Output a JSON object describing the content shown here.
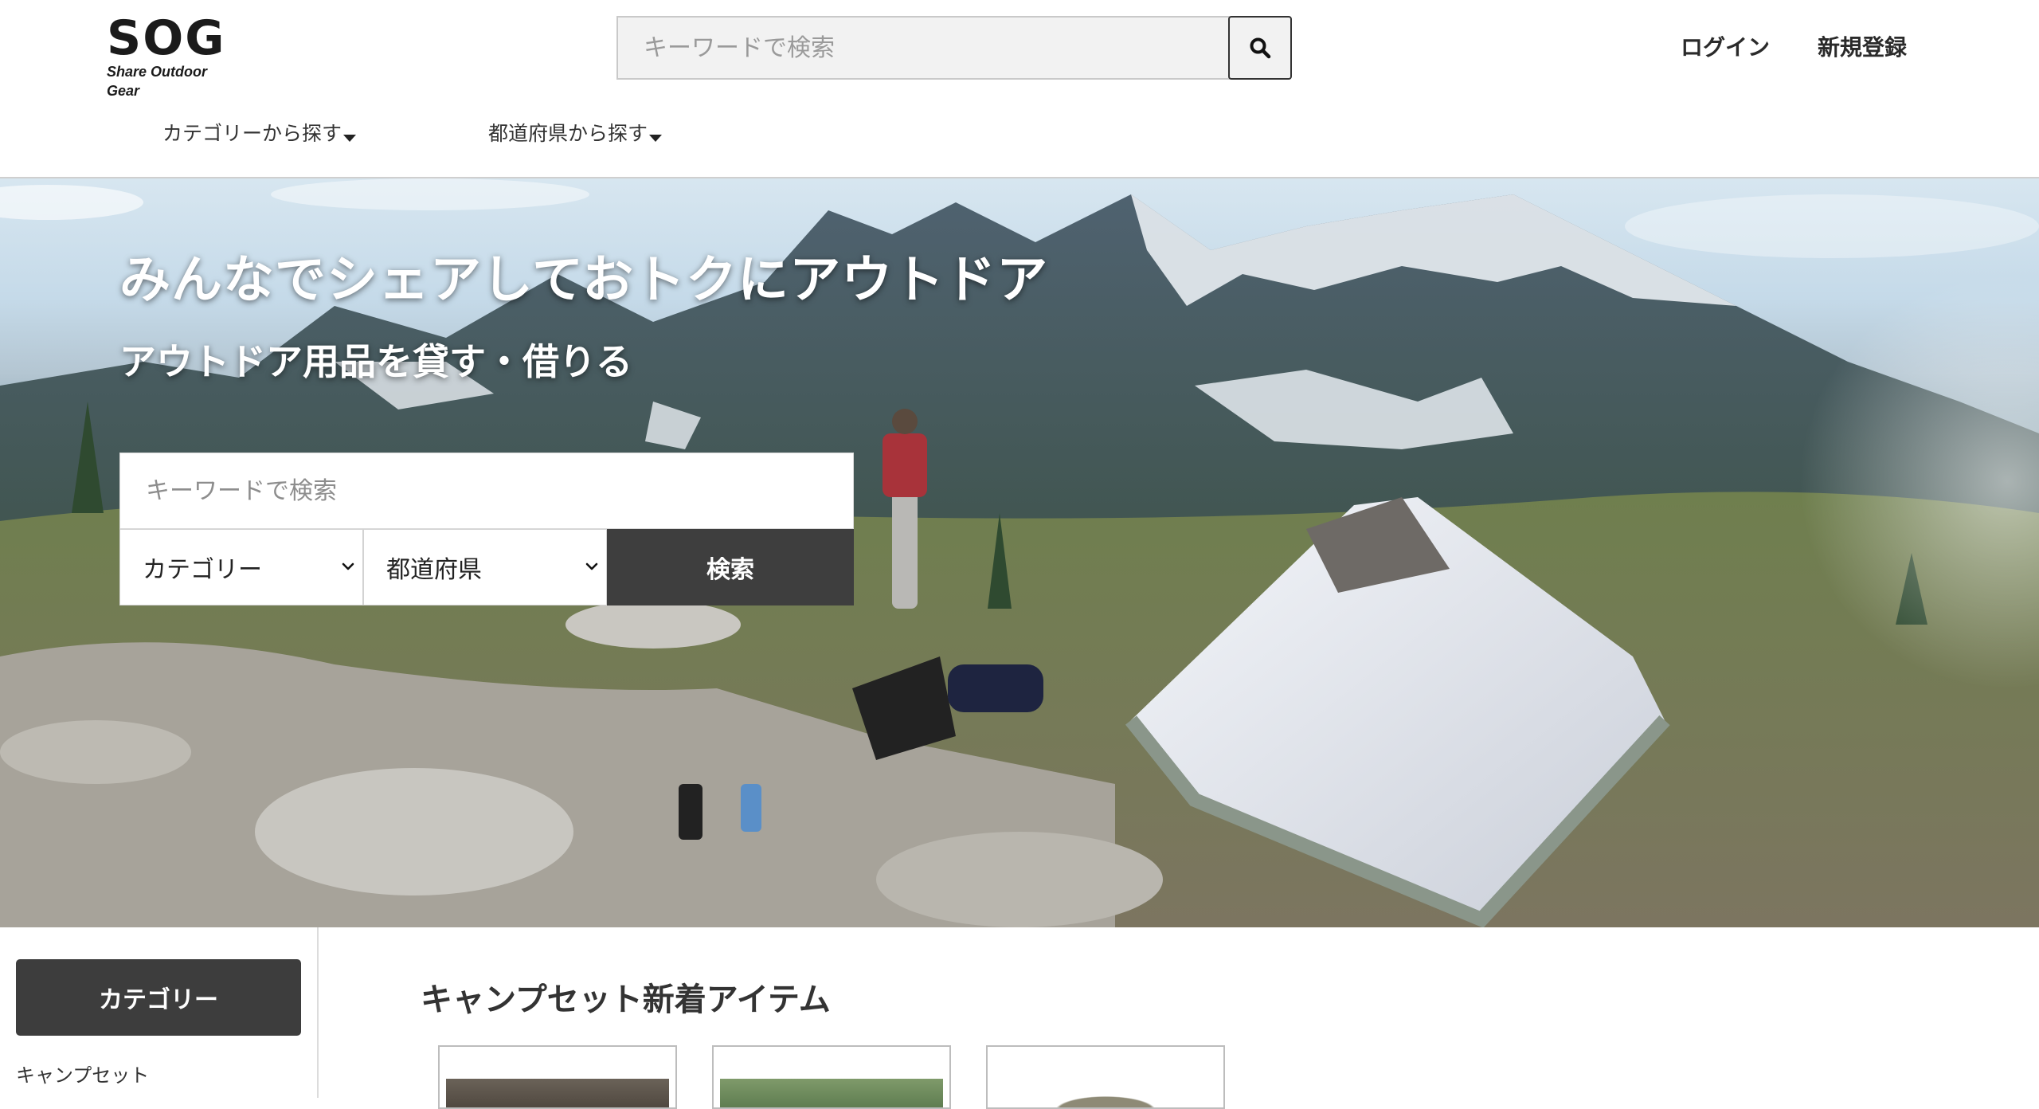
{
  "brand": {
    "logo_mark": "SOG",
    "logo_sub": "Share Outdoor Gear"
  },
  "header": {
    "search_placeholder": "キーワードで検索",
    "search_icon": "search-icon",
    "login": "ログイン",
    "register": "新規登録",
    "nav": [
      {
        "label": "カテゴリーから探す"
      },
      {
        "label": "都道府県から探す"
      }
    ]
  },
  "hero": {
    "title": "みんなでシェアしておトクにアウトドア",
    "subtitle": "アウトドア用品を貸す・借りる",
    "search_placeholder": "キーワードで検索",
    "category_select": "カテゴリー",
    "prefecture_select": "都道府県",
    "search_button": "検索"
  },
  "sidebar": {
    "heading": "カテゴリー",
    "items": [
      {
        "label": "キャンプセット"
      }
    ]
  },
  "main": {
    "section_title": "キャンプセット新着アイテム"
  },
  "colors": {
    "dark_button": "#3e3e3e",
    "text": "#333333",
    "accent_dark": "#3d3d3d"
  }
}
